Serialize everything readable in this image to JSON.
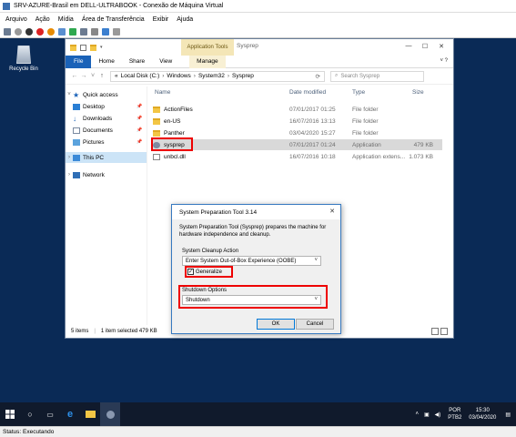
{
  "vm": {
    "title": "SRV-AZURE-Brasil em DELL-ULTRABOOK - Conexão de Máquina Virtual",
    "menu": [
      "Arquivo",
      "Ação",
      "Mídia",
      "Área de Transferência",
      "Exibir",
      "Ajuda"
    ],
    "status": "Status: Executando"
  },
  "desktop": {
    "recycle_bin_label": "Recycle Bin"
  },
  "explorer": {
    "context_tab": "Application Tools",
    "caption": "Sysprep",
    "tabs": [
      "File",
      "Home",
      "Share",
      "View",
      "Manage"
    ],
    "breadcrumbs": [
      "«",
      "Local Disk (C:)",
      "Windows",
      "System32",
      "Sysprep"
    ],
    "search_placeholder": "Search Sysprep",
    "nav": {
      "quick_access": "Quick access",
      "desktop": "Desktop",
      "downloads": "Downloads",
      "documents": "Documents",
      "pictures": "Pictures",
      "this_pc": "This PC",
      "network": "Network"
    },
    "columns": [
      "Name",
      "Date modified",
      "Type",
      "Size"
    ],
    "files": [
      {
        "name": "ActionFiles",
        "date": "07/01/2017 01:25",
        "type": "File folder",
        "size": ""
      },
      {
        "name": "en-US",
        "date": "16/07/2016 13:13",
        "type": "File folder",
        "size": ""
      },
      {
        "name": "Panther",
        "date": "03/04/2020 15:27",
        "type": "File folder",
        "size": ""
      },
      {
        "name": "sysprep",
        "date": "07/01/2017 01:24",
        "type": "Application",
        "size": "479 KB"
      },
      {
        "name": "unbcl.dll",
        "date": "16/07/2016 10:18",
        "type": "Application extens...",
        "size": "1.073 KB"
      }
    ],
    "status_items": "5 items",
    "status_selected": "1 item selected  479 KB"
  },
  "dialog": {
    "title": "System Preparation Tool 3.14",
    "description": "System Preparation Tool (Sysprep) prepares the machine for hardware independence and cleanup.",
    "cleanup_label": "System Cleanup Action",
    "cleanup_value": "Enter System Out-of-Box Experience (OOBE)",
    "generalize_label": "Generalize",
    "generalize_checked": true,
    "shutdown_label": "Shutdown Options",
    "shutdown_value": "Shutdown",
    "ok_label": "OK",
    "cancel_label": "Cancel"
  },
  "taskbar": {
    "lang_top": "POR",
    "lang_bottom": "PTB2",
    "time": "15:30",
    "date": "03/04/2020"
  },
  "colors": {
    "desktop": "#0a2a56",
    "accent": "#1a62b8",
    "highlight_box": "#ee0000",
    "context_tab": "#f4e6b7"
  }
}
